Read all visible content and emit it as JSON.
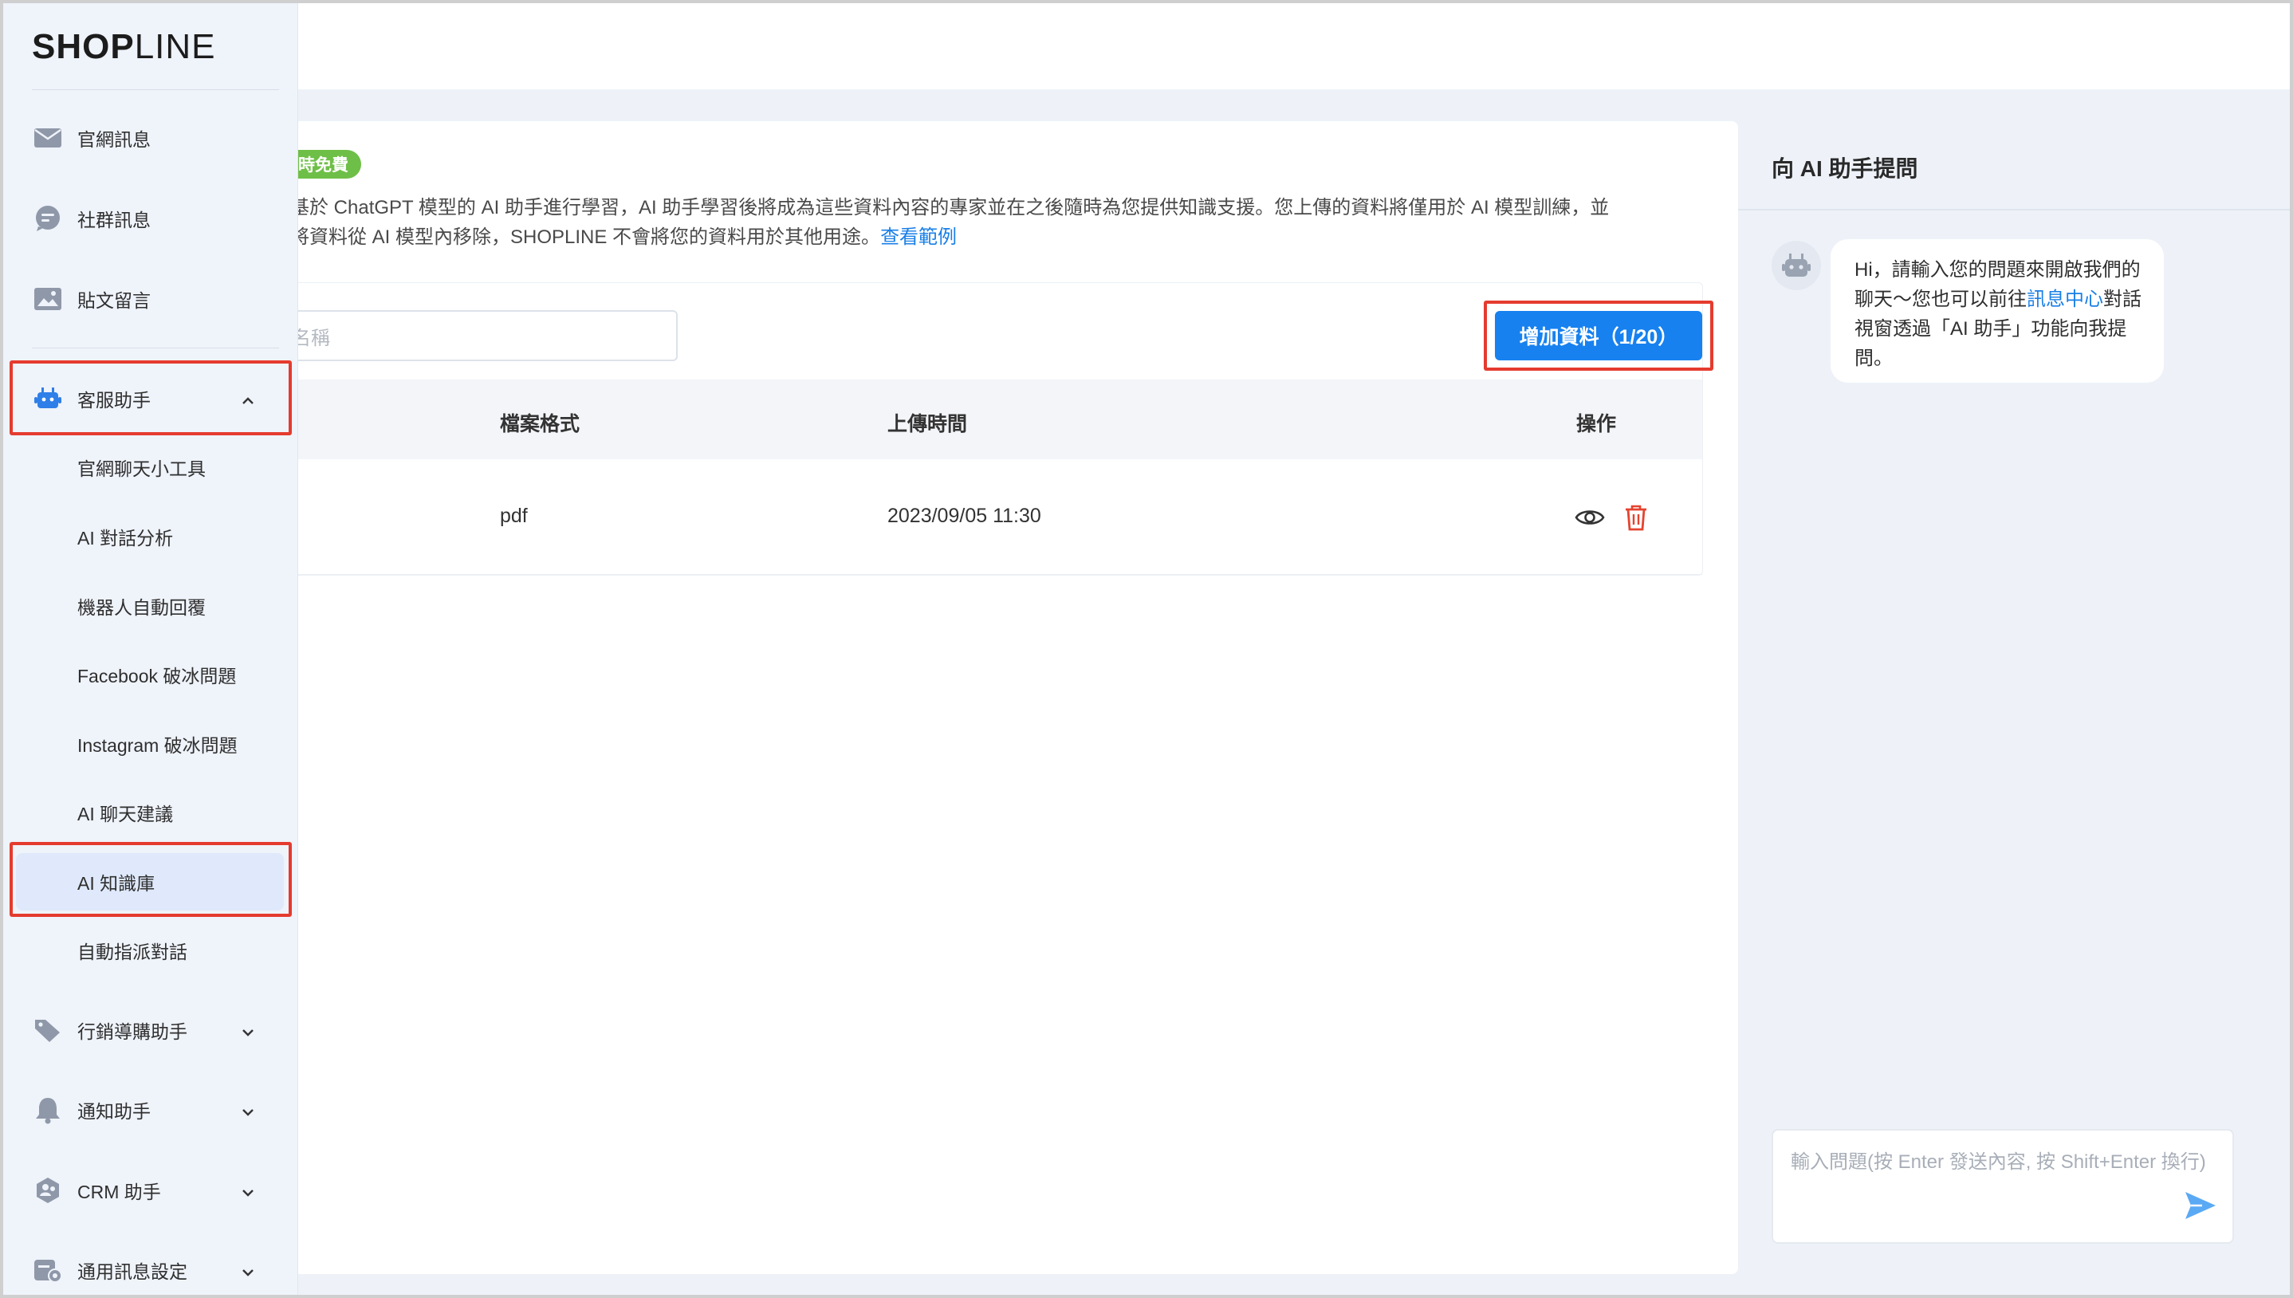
{
  "brand": {
    "logo_bold": "SHOP",
    "logo_light": "LINE"
  },
  "sidebar": {
    "items": [
      {
        "label": "官網訊息",
        "icon": "envelope-icon"
      },
      {
        "label": "社群訊息",
        "icon": "chat-bubble-icon"
      },
      {
        "label": "貼文留言",
        "icon": "image-icon"
      }
    ],
    "section": {
      "label": "客服助手",
      "icon": "robot-icon",
      "expanded": true
    },
    "sub_items": [
      {
        "label": "官網聊天小工具"
      },
      {
        "label": "AI 對話分析"
      },
      {
        "label": "機器人自動回覆"
      },
      {
        "label": "Facebook 破冰問題"
      },
      {
        "label": "Instagram 破冰問題"
      },
      {
        "label": "AI 聊天建議"
      },
      {
        "label": "AI 知識庫",
        "active": true
      },
      {
        "label": "自動指派對話"
      }
    ],
    "groups": [
      {
        "label": "行銷導購助手",
        "icon": "tag-icon"
      },
      {
        "label": "通知助手",
        "icon": "bell-icon"
      },
      {
        "label": "CRM 助手",
        "icon": "crm-icon"
      },
      {
        "label": "通用訊息設定",
        "icon": "settings-icon"
      }
    ]
  },
  "main": {
    "badge": "時免費",
    "description_line1": "基於 ChatGPT 模型的 AI 助手進行學習，AI 助手學習後將成為這些資料內容的專家並在之後隨時為您提供知識支援。您上傳的資料將僅用於 AI 模型訓練，並",
    "description_line2": "將資料從 AI 模型內移除，SHOPLINE 不會將您的資料用於其他用途。",
    "description_link": "查看範例",
    "search_placeholder": "名稱",
    "add_button": "增加資料（1/20）",
    "table": {
      "headers": {
        "format": "檔案格式",
        "uploaded": "上傳時間",
        "actions": "操作"
      },
      "rows": [
        {
          "format": "pdf",
          "uploaded": "2023/09/05 11:30"
        }
      ]
    }
  },
  "chat": {
    "title": "向 AI 助手提問",
    "greeting_before_link": "Hi，請輸入您的問題來開啟我們的聊天～您也可以前往",
    "greeting_link": "訊息中心",
    "greeting_after_link": "對話視窗透過「AI 助手」功能向我提問。",
    "input_placeholder": "輸入問題(按 Enter 發送內容, 按 Shift+Enter 換行)"
  },
  "colors": {
    "accent": "#1781ef",
    "highlight": "#e53b2f",
    "badge": "#6ebf47",
    "delete": "#e5432f"
  }
}
